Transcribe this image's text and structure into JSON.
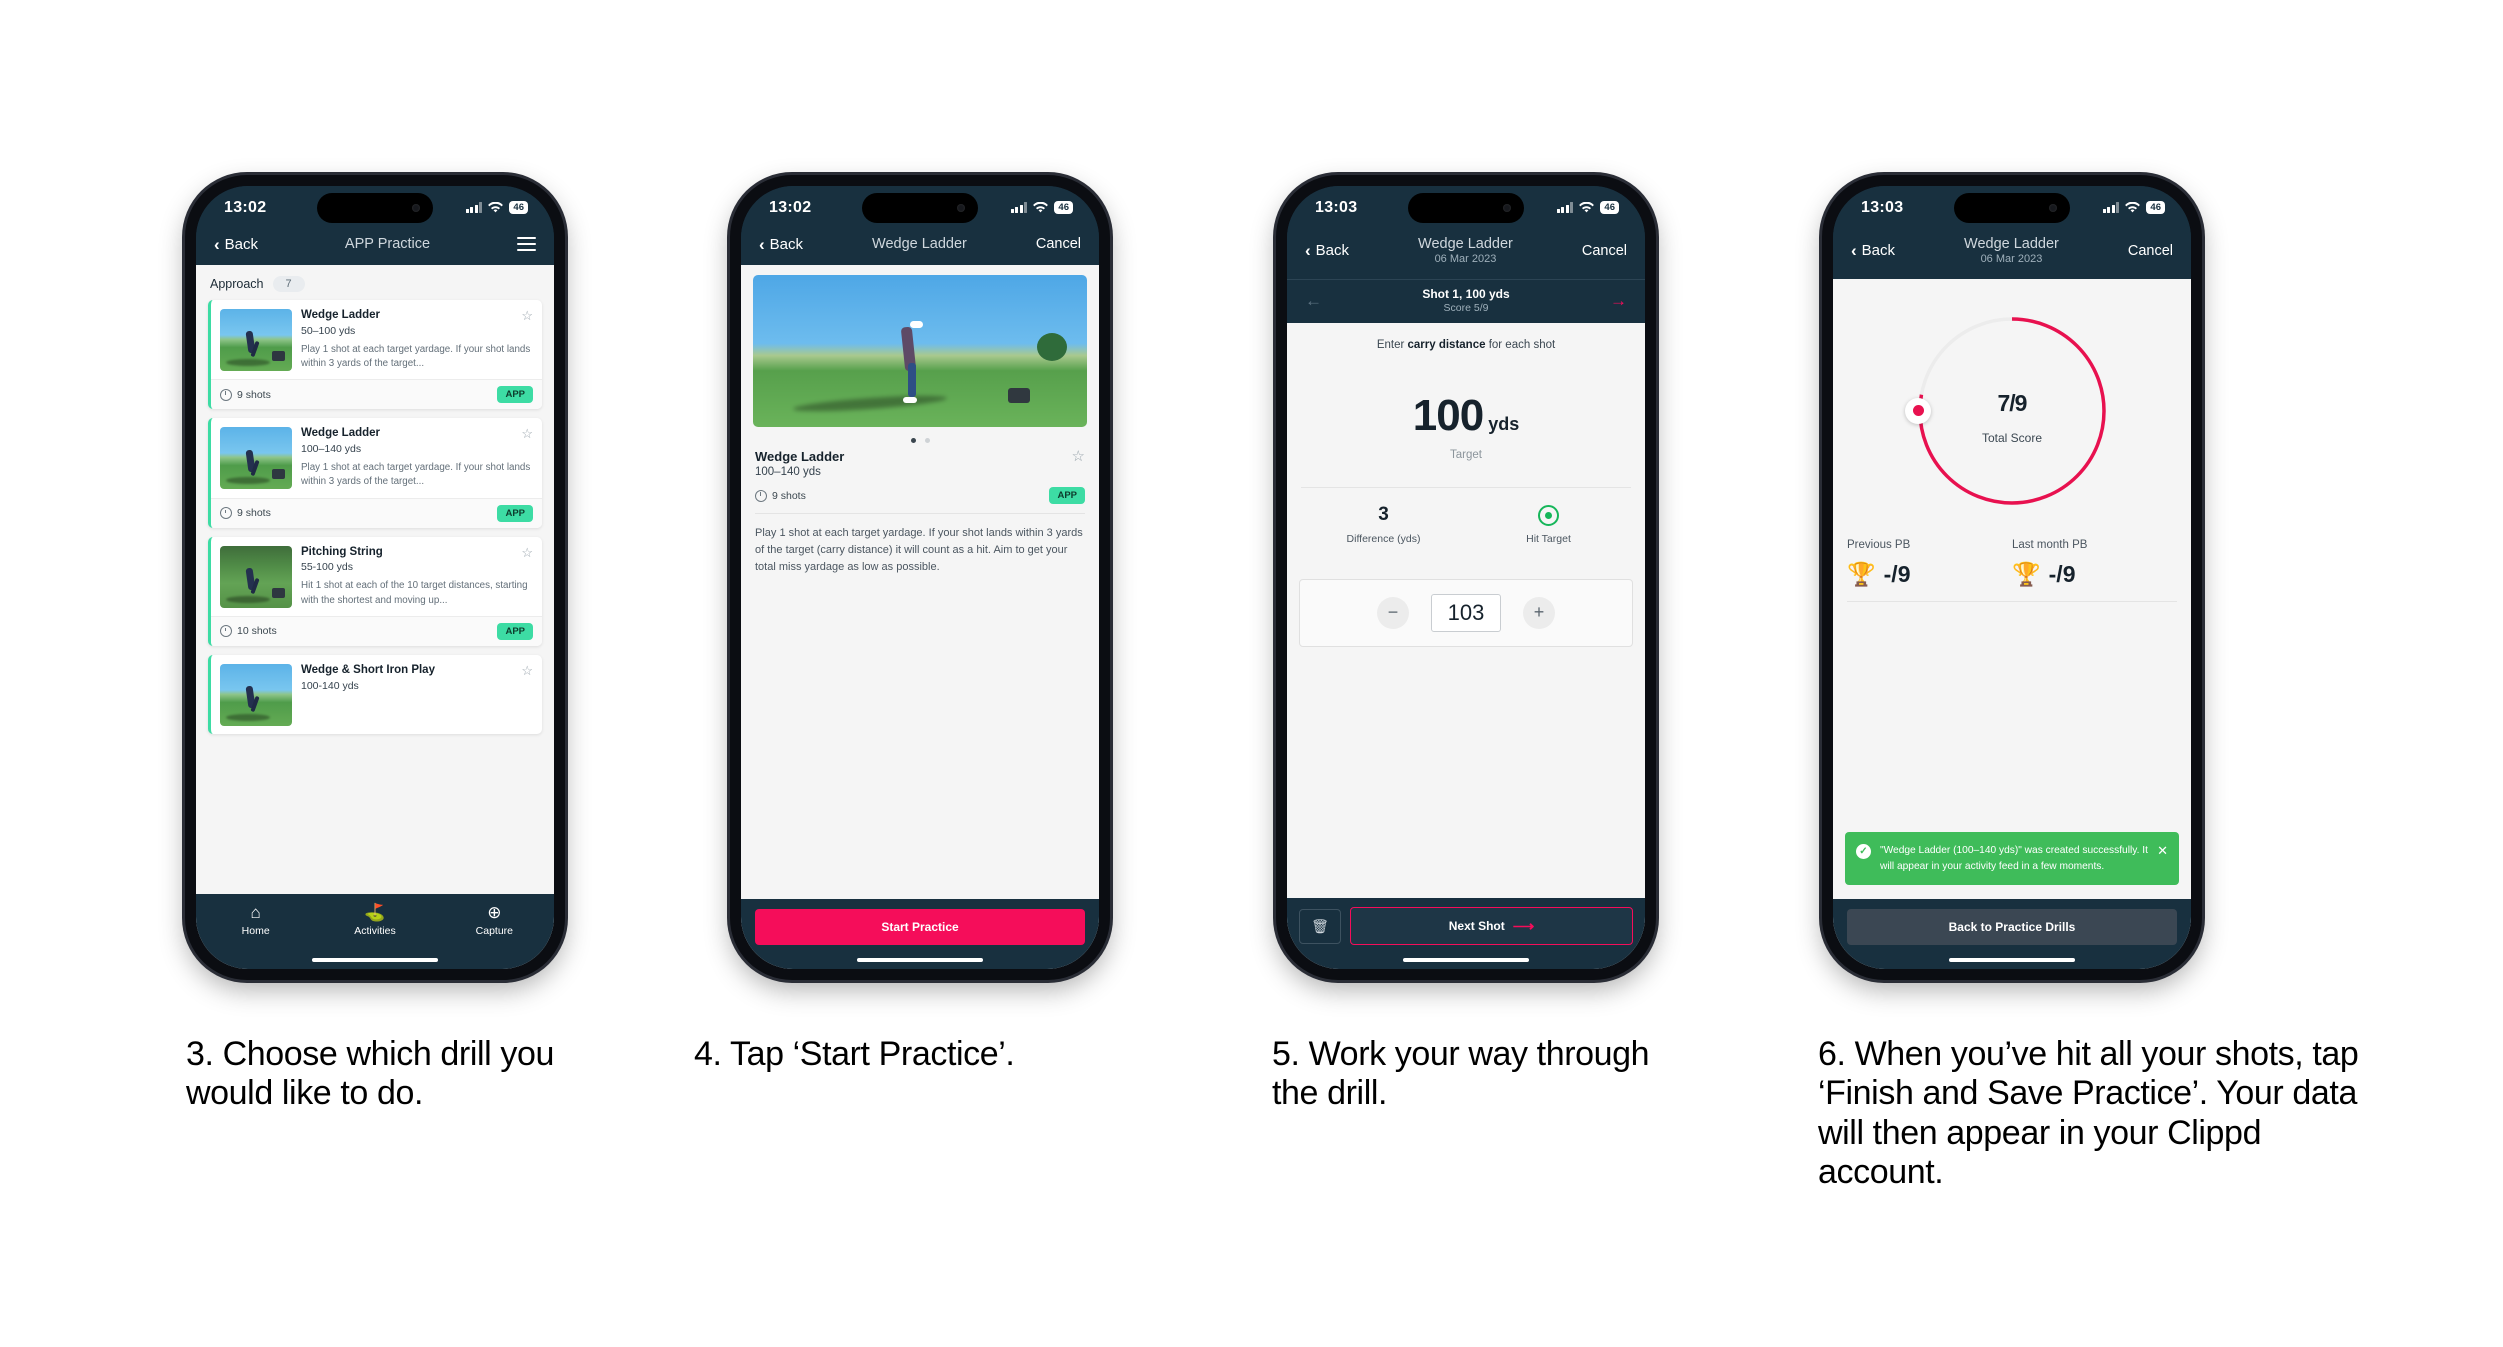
{
  "phones": [
    {
      "status": {
        "time": "13:02",
        "battery": "46"
      },
      "nav": {
        "back": "Back",
        "title": "APP Practice",
        "menu_icon": "hamburger-icon"
      },
      "section": {
        "label": "Approach",
        "count": "7"
      },
      "cards": [
        {
          "title": "Wedge Ladder",
          "range": "50–100 yds",
          "desc": "Play 1 shot at each target yardage. If your shot lands within 3 yards of the target...",
          "shots": "9 shots",
          "badge": "APP"
        },
        {
          "title": "Wedge Ladder",
          "range": "100–140 yds",
          "desc": "Play 1 shot at each target yardage. If your shot lands within 3 yards of the target...",
          "shots": "9 shots",
          "badge": "APP"
        },
        {
          "title": "Pitching String",
          "range": "55-100 yds",
          "desc": "Hit 1 shot at each of the 10 target distances, starting with the shortest and moving up...",
          "shots": "10 shots",
          "badge": "APP"
        },
        {
          "title": "Wedge & Short Iron Play",
          "range": "100-140 yds",
          "desc": "",
          "shots": "",
          "badge": ""
        }
      ],
      "tabs": [
        {
          "label": "Home",
          "icon": "home-icon"
        },
        {
          "label": "Activities",
          "icon": "golf-flag-icon"
        },
        {
          "label": "Capture",
          "icon": "plus-circle-icon"
        }
      ]
    },
    {
      "status": {
        "time": "13:02",
        "battery": "46"
      },
      "nav": {
        "back": "Back",
        "title": "Wedge Ladder",
        "right": "Cancel"
      },
      "detail": {
        "title": "Wedge Ladder",
        "range": "100–140 yds",
        "shots": "9 shots",
        "badge": "APP",
        "description": "Play 1 shot at each target yardage. If your shot lands within 3 yards of the target (carry distance) it will count as a hit. Aim to get your total miss yardage as low as possible."
      },
      "cta": "Start Practice"
    },
    {
      "status": {
        "time": "13:03",
        "battery": "46"
      },
      "nav": {
        "back": "Back",
        "title": "Wedge Ladder",
        "subtitle": "06 Mar 2023",
        "right": "Cancel"
      },
      "shotbar": {
        "title": "Shot 1, 100 yds",
        "score": "Score 5/9",
        "prev_icon": "arrow-left-icon",
        "next_icon": "arrow-right-icon"
      },
      "prompt_pre": "Enter ",
      "prompt_bold": "carry distance",
      "prompt_post": " for each shot",
      "target": {
        "value": "100",
        "unit": "yds",
        "label": "Target"
      },
      "stats": [
        {
          "value": "3",
          "label": "Difference (yds)"
        },
        {
          "value": "",
          "label": "Hit Target",
          "icon": "target-hit-icon"
        }
      ],
      "stepper": {
        "minus": "−",
        "value": "103",
        "plus": "+"
      },
      "footer": {
        "delete_icon": "trash-icon",
        "next": "Next Shot"
      }
    },
    {
      "status": {
        "time": "13:03",
        "battery": "46"
      },
      "nav": {
        "back": "Back",
        "title": "Wedge Ladder",
        "subtitle": "06 Mar 2023",
        "right": "Cancel"
      },
      "gauge": {
        "score": "7",
        "of": "/9",
        "caption": "Total Score",
        "percent": 77.8,
        "accent": "#e8114f"
      },
      "pbs": [
        {
          "label": "Previous PB",
          "value": "-/9",
          "icon": "trophy-icon"
        },
        {
          "label": "Last month PB",
          "value": "-/9",
          "icon": "trophy-icon"
        }
      ],
      "toast": {
        "text": "\"Wedge Ladder (100–140 yds)\" was created successfully. It will appear in your activity feed in a few moments.",
        "check_icon": "check-circle-icon",
        "close_icon": "close-icon",
        "color": "#3fbc5a"
      },
      "cta": "Back to Practice Drills"
    }
  ],
  "captions": [
    "3. Choose which drill you would like to do.",
    "4. Tap ‘Start Practice’.",
    "5. Work your way through the drill.",
    "6. When you’ve hit all your shots, tap ‘Finish and Save Practice’. Your data will then appear in your Clippd account."
  ],
  "colors": {
    "nav_dark": "#18303f",
    "accent_pink": "#f50d5a",
    "accent_green": "#3ddca4",
    "toast_green": "#3fbc5a"
  }
}
